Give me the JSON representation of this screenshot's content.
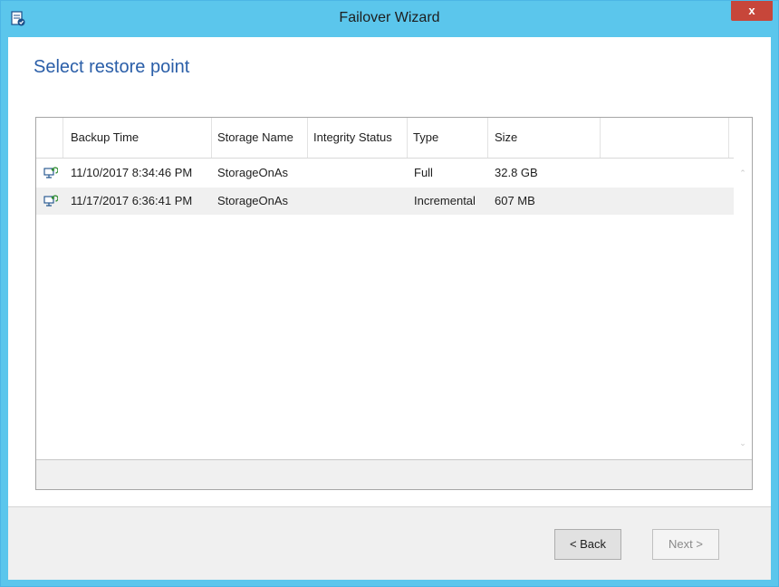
{
  "window": {
    "title": "Failover Wizard",
    "close_label": "x"
  },
  "page": {
    "heading": "Select restore point"
  },
  "table": {
    "columns": [
      "Backup Time",
      "Storage Name",
      "Integrity Status",
      "Type",
      "Size"
    ],
    "rows": [
      {
        "backup_time": "11/10/2017 8:34:46 PM",
        "storage_name": "StorageOnAs",
        "integrity_status": "",
        "type": "Full",
        "size": "32.8 GB"
      },
      {
        "backup_time": "11/17/2017 6:36:41 PM",
        "storage_name": "StorageOnAs",
        "integrity_status": "",
        "type": "Incremental",
        "size": "607 MB"
      }
    ]
  },
  "footer": {
    "back_label": "< Back",
    "next_label": "Next >"
  },
  "icons": {
    "app": "wizard-app-icon",
    "row": "computer-restore-icon",
    "scroll_up": "scroll-up-icon",
    "scroll_down": "scroll-down-icon"
  },
  "colors": {
    "titlebar": "#5bc6ec",
    "close_button": "#c7463a",
    "heading": "#2a5ea8",
    "row_alt": "#f0f0f0"
  }
}
